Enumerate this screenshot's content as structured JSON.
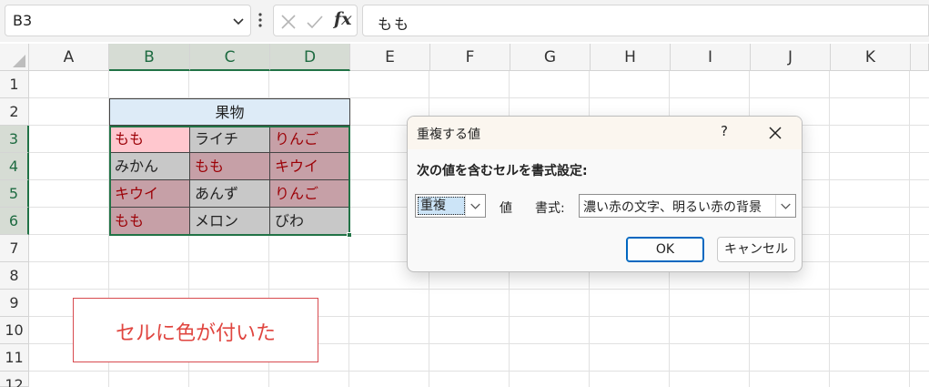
{
  "formula_bar": {
    "name_box": "B3",
    "formula": "もも",
    "fx_label": "fx"
  },
  "columns": [
    "A",
    "B",
    "C",
    "D",
    "E",
    "F",
    "G",
    "H",
    "I",
    "J",
    "K"
  ],
  "selected_columns": [
    "B",
    "C",
    "D"
  ],
  "rows": [
    "1",
    "2",
    "3",
    "4",
    "5",
    "6",
    "7",
    "8",
    "9",
    "10",
    "11",
    "12"
  ],
  "selected_rows": [
    "3",
    "4",
    "5",
    "6"
  ],
  "table": {
    "header": "果物",
    "rows": [
      [
        "もも",
        "ライチ",
        "りんご"
      ],
      [
        "みかん",
        "もも",
        "キウイ"
      ],
      [
        "キウイ",
        "あんず",
        "りんご"
      ],
      [
        "もも",
        "メロン",
        "びわ"
      ]
    ]
  },
  "annotation": {
    "text": "セルに色が付いた"
  },
  "dialog": {
    "title": "重複する値",
    "help": "?",
    "instruction": "次の値を含むセルを書式設定:",
    "type_value": "重複",
    "values_label": "値",
    "format_label": "書式:",
    "format_value": "濃い赤の文字、明るい赤の背景",
    "ok_label": "OK",
    "cancel_label": "キャンセル"
  },
  "colors": {
    "selection_green": "#217346",
    "duplicate_fill": "#ffc7ce",
    "duplicate_text": "#9c0006",
    "header_fill": "#ddebf7",
    "annotation_red": "#e0453f"
  }
}
